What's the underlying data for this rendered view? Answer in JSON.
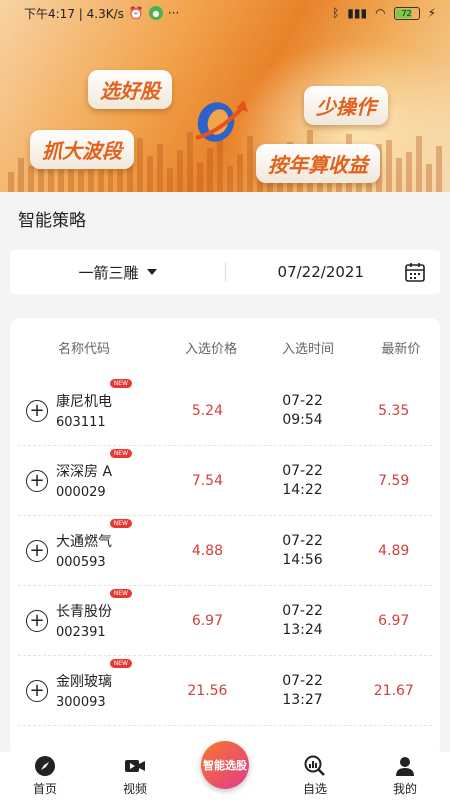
{
  "status_bar": {
    "time_network": "下午4:17 | 4.3K/s",
    "battery": "72"
  },
  "banner": {
    "tags": [
      "选好股",
      "少操作",
      "抓大波段",
      "按年算收益"
    ]
  },
  "section_title": "智能策略",
  "filter": {
    "strategy": "一箭三雕",
    "date": "07/22/2021"
  },
  "table": {
    "headers": [
      "名称代码",
      "入选价格",
      "入选时间",
      "最新价"
    ],
    "badge": "NEW",
    "rows": [
      {
        "name": "康尼机电",
        "code": "603111",
        "price": "5.24",
        "date": "07-22",
        "time": "09:54",
        "latest": "5.35"
      },
      {
        "name": "深深房 A",
        "code": "000029",
        "price": "7.54",
        "date": "07-22",
        "time": "14:22",
        "latest": "7.59"
      },
      {
        "name": "大通燃气",
        "code": "000593",
        "price": "4.88",
        "date": "07-22",
        "time": "14:56",
        "latest": "4.89"
      },
      {
        "name": "长青股份",
        "code": "002391",
        "price": "6.97",
        "date": "07-22",
        "time": "13:24",
        "latest": "6.97"
      },
      {
        "name": "金刚玻璃",
        "code": "300093",
        "price": "21.56",
        "date": "07-22",
        "time": "13:27",
        "latest": "21.67"
      }
    ]
  },
  "tabbar": {
    "home": "首页",
    "video": "视频",
    "center": "智能选股",
    "watchlist": "自选",
    "mine": "我的"
  },
  "colors": {
    "accent_red": "#d2403c",
    "banner_orange": "#e8822a"
  }
}
